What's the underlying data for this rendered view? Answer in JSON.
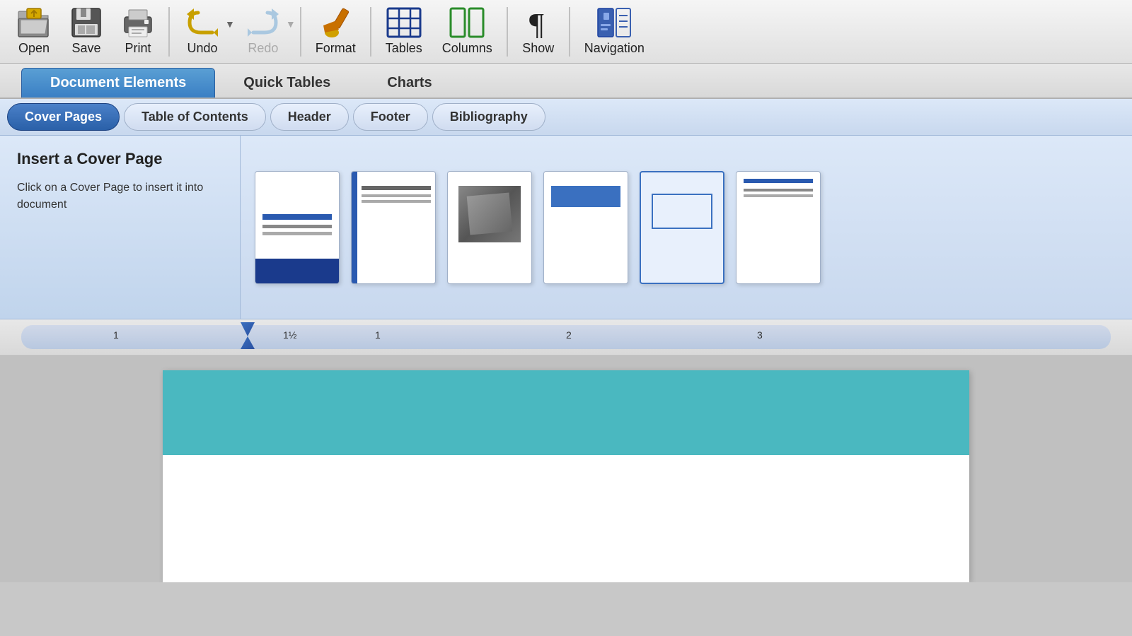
{
  "toolbar": {
    "items": [
      {
        "id": "open",
        "label": "Open",
        "icon": "folder-open-icon"
      },
      {
        "id": "save",
        "label": "Save",
        "icon": "save-icon"
      },
      {
        "id": "print",
        "label": "Print",
        "icon": "print-icon"
      },
      {
        "id": "undo",
        "label": "Undo",
        "icon": "undo-icon"
      },
      {
        "id": "redo",
        "label": "Redo",
        "icon": "redo-icon",
        "disabled": true
      },
      {
        "id": "format",
        "label": "Format",
        "icon": "format-icon"
      },
      {
        "id": "tables",
        "label": "Tables",
        "icon": "tables-icon"
      },
      {
        "id": "columns",
        "label": "Columns",
        "icon": "columns-icon"
      },
      {
        "id": "show",
        "label": "Show",
        "icon": "show-icon"
      },
      {
        "id": "navigation",
        "label": "Navigation",
        "icon": "navigation-icon"
      }
    ]
  },
  "ribbon": {
    "tabs": [
      {
        "id": "document-elements",
        "label": "Document Elements",
        "active": true
      },
      {
        "id": "quick-tables",
        "label": "Quick Tables",
        "active": false
      },
      {
        "id": "charts",
        "label": "Charts",
        "active": false
      }
    ]
  },
  "sub_tabs": [
    {
      "id": "cover-pages",
      "label": "Cover Pages",
      "active": true
    },
    {
      "id": "table-of-contents",
      "label": "Table of Contents",
      "active": false
    },
    {
      "id": "header",
      "label": "Header",
      "active": false
    },
    {
      "id": "footer",
      "label": "Footer",
      "active": false
    },
    {
      "id": "bibliography",
      "label": "Bibliography",
      "active": false
    }
  ],
  "cover_page_panel": {
    "title": "Insert a Cover Page",
    "description": "Click on a Cover Page to insert it into document"
  },
  "templates": [
    {
      "id": "tmpl1",
      "name": "template-1"
    },
    {
      "id": "tmpl2",
      "name": "template-2"
    },
    {
      "id": "tmpl3",
      "name": "template-3"
    },
    {
      "id": "tmpl4",
      "name": "template-4"
    },
    {
      "id": "tmpl5",
      "name": "template-5",
      "selected": true
    },
    {
      "id": "tmpl6",
      "name": "template-6"
    }
  ],
  "ruler": {
    "marks": [
      "1",
      "1½",
      "2",
      "3"
    ]
  }
}
